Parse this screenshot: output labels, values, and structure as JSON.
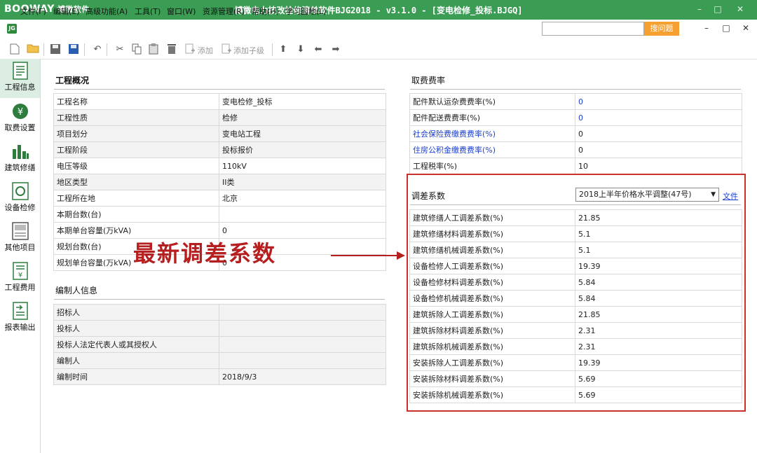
{
  "window": {
    "logo_text": "BOOWAY",
    "logo_cn": "博微软件",
    "title": "博微电力技改检修清单软件BJG2018 - v3.1.0 - [变电检修_投标.BJGQ]",
    "min_icon": "–",
    "max_icon": "□",
    "close_icon": "✕"
  },
  "menubar": {
    "app_badge": "JG",
    "items": [
      "文件(F)",
      "编辑(E)",
      "高级功能(A)",
      "工具(T)",
      "窗口(W)",
      "资源管理(R)",
      "帮助(H)",
      "学习园地(L)"
    ],
    "search_placeholder": "",
    "search_button": "搜问题",
    "mdi_min": "–",
    "mdi_max": "□",
    "mdi_close": "✕"
  },
  "toolbar": {
    "add_label": "添加",
    "add_child_label": "添加子级"
  },
  "leftnav": {
    "items": [
      {
        "label": "工程信息",
        "icon": "project-info-icon"
      },
      {
        "label": "取费设置",
        "icon": "fee-settings-icon"
      },
      {
        "label": "建筑修缮",
        "icon": "building-repair-icon"
      },
      {
        "label": "设备检修",
        "icon": "equipment-maintenance-icon"
      },
      {
        "label": "其他项目",
        "icon": "other-items-icon"
      },
      {
        "label": "工程费用",
        "icon": "project-cost-icon"
      },
      {
        "label": "报表输出",
        "icon": "report-output-icon"
      }
    ]
  },
  "overview": {
    "title": "工程概况",
    "rows": [
      {
        "label": "工程名称",
        "value": "变电检修_投标"
      },
      {
        "label": "工程性质",
        "value": "检修"
      },
      {
        "label": "项目划分",
        "value": "变电站工程"
      },
      {
        "label": "工程阶段",
        "value": "投标报价"
      },
      {
        "label": "电压等级",
        "value": "110kV"
      },
      {
        "label": "地区类型",
        "value": "II类"
      },
      {
        "label": "工程所在地",
        "value": "北京"
      },
      {
        "label": "本期台数(台)",
        "value": ""
      },
      {
        "label": "本期单台容量(万kVA)",
        "value": "0"
      },
      {
        "label": "规划台数(台)",
        "value": ""
      },
      {
        "label": "规划单台容量(万kVA)",
        "value": "0"
      }
    ]
  },
  "editors": {
    "title": "编制人信息",
    "rows": [
      {
        "label": "招标人",
        "value": ""
      },
      {
        "label": "投标人",
        "value": ""
      },
      {
        "label": "投标人法定代表人或其授权人",
        "value": ""
      },
      {
        "label": "编制人",
        "value": ""
      },
      {
        "label": "编制时间",
        "value": "2018/9/3"
      }
    ]
  },
  "fees": {
    "title": "取费费率",
    "rows": [
      {
        "label": "配件默认运杂费费率(%)",
        "value": "0"
      },
      {
        "label": "配件配送费费率(%)",
        "value": "0"
      },
      {
        "label": "社会保险费缴费费率(%)",
        "value": "0"
      },
      {
        "label": "住房公积金缴费费率(%)",
        "value": "0"
      },
      {
        "label": "工程税率(%)",
        "value": "10"
      }
    ]
  },
  "coefficients": {
    "title": "调差系数",
    "select_value": "2018上半年价格水平调整(47号)",
    "link_text": "文件",
    "rows": [
      {
        "label": "建筑修缮人工调差系数(%)",
        "value": "21.85"
      },
      {
        "label": "建筑修缮材料调差系数(%)",
        "value": "5.1"
      },
      {
        "label": "建筑修缮机械调差系数(%)",
        "value": "5.1"
      },
      {
        "label": "设备检修人工调差系数(%)",
        "value": "19.39"
      },
      {
        "label": "设备检修材料调差系数(%)",
        "value": "5.84"
      },
      {
        "label": "设备检修机械调差系数(%)",
        "value": "5.84"
      },
      {
        "label": "建筑拆除人工调差系数(%)",
        "value": "21.85"
      },
      {
        "label": "建筑拆除材料调差系数(%)",
        "value": "2.31"
      },
      {
        "label": "建筑拆除机械调差系数(%)",
        "value": "2.31"
      },
      {
        "label": "安装拆除人工调差系数(%)",
        "value": "19.39"
      },
      {
        "label": "安装拆除材料调差系数(%)",
        "value": "5.69"
      },
      {
        "label": "安装拆除机械调差系数(%)",
        "value": "5.69"
      }
    ]
  },
  "annotation": {
    "text": "最新调差系数"
  },
  "colors": {
    "titlebar": "#3b9c54",
    "annotation": "#b51f1f",
    "link": "#1a3fd0",
    "search_button": "#f5a030"
  }
}
